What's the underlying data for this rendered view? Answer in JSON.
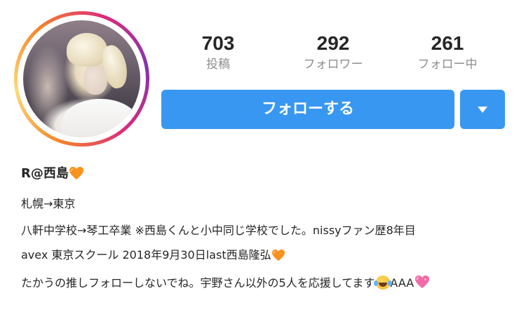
{
  "profile": {
    "display_name": "R@西島",
    "avatar_alt": "profile-photo"
  },
  "stats": {
    "posts": {
      "count": "703",
      "label": "投稿"
    },
    "followers": {
      "count": "292",
      "label": "フォロワー"
    },
    "following": {
      "count": "261",
      "label": "フォロー中"
    }
  },
  "actions": {
    "follow_label": "フォローする",
    "more_icon": "dropdown-triangle"
  },
  "bio": {
    "line1": "札幌→東京",
    "line2": "八軒中学校→琴工卒業 ※西島くんと小中同じ学校でした。nissyファン歴8年目",
    "line3": "avex 東京スクール 2018年9月30日last西島隆弘",
    "line4_text": "たかうの推しフォローしないでね。宇野さん以外の5人を応援してます",
    "line4_tail": "AAA"
  },
  "icons": {
    "name_emoji": "orange-heart-icon",
    "line3_emoji": "orange-heart-icon",
    "line4_emoji1": "tears-of-joy-icon",
    "line4_emoji2": "sparkling-pink-heart-icon"
  },
  "colors": {
    "primary_button": "#3897f0",
    "stat_label": "#8e8e8e",
    "text": "#262626",
    "orange_heart": "#f7931e",
    "pink_heart": "#f06ba8"
  }
}
